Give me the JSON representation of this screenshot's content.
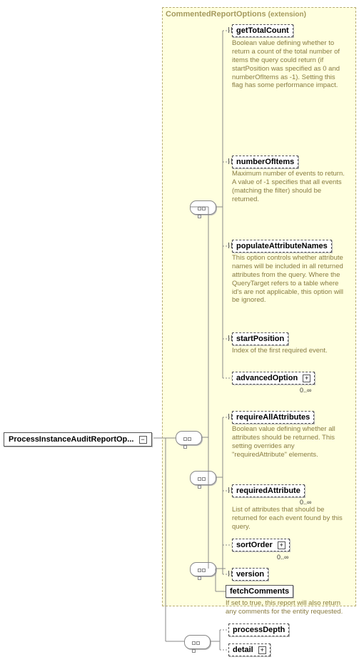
{
  "root": {
    "label": "ProcessInstanceAuditReportOp..."
  },
  "extension": {
    "title": "CommentedReportOptions",
    "note": "(extension)"
  },
  "elements": {
    "getTotalCount": {
      "label": "getTotalCount",
      "desc": "Boolean value defining whether to return a count of the total number of items the query could return (if startPosition was specified as 0 and numberOfItems as -1).\n\nSetting this flag has some performance impact."
    },
    "numberOfItems": {
      "label": "numberOfItems",
      "desc": "Maximum number of events to return.\n\nA value of -1 specifies that all events (matching the filter) should be returned."
    },
    "populateAttributeNames": {
      "label": "populateAttributeNames",
      "desc": "This option controls whether attribute names will be included in all returned attributes from the query. Where the QueryTarget refers to a table where id's are not applicable, this option will be ignored."
    },
    "startPosition": {
      "label": "startPosition",
      "desc": "Index of the first required event."
    },
    "advancedOption": {
      "label": "advancedOption",
      "occ": "0..∞"
    },
    "requireAllAttributes": {
      "label": "requireAllAttributes",
      "desc": "Boolean value defining whether all attributes should be returned.\nThis setting overrides any \"requiredAttribute\" elements."
    },
    "requiredAttribute": {
      "label": "requiredAttribute",
      "desc": "List of attributes that should be returned for each event found by this query.",
      "occ": "0..∞"
    },
    "sortOrder": {
      "label": "sortOrder",
      "occ": "0..∞"
    },
    "version": {
      "label": "version"
    },
    "fetchComments": {
      "label": "fetchComments",
      "desc": "If set to true, this report will also return any comments for the entity requested."
    },
    "processDepth": {
      "label": "processDepth"
    },
    "detail": {
      "label": "detail"
    }
  }
}
